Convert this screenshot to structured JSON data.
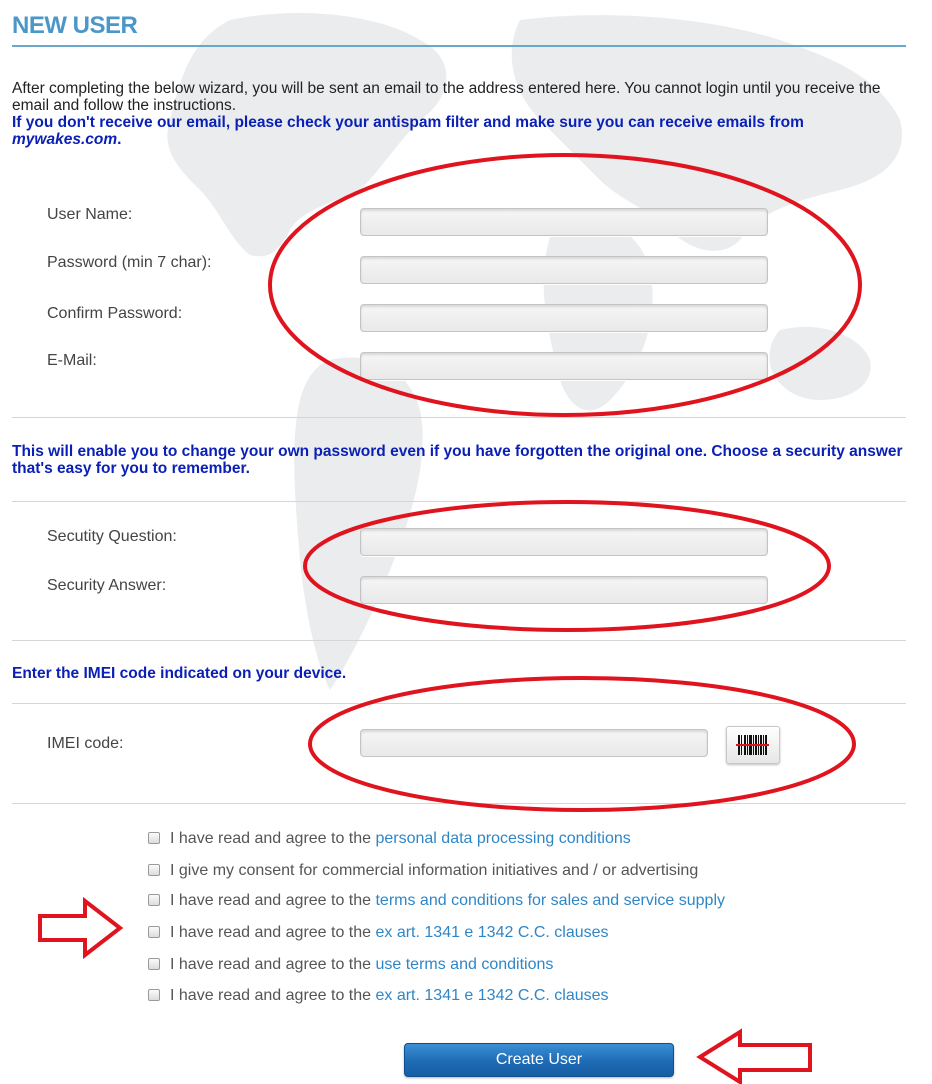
{
  "header": {
    "title": "NEW USER"
  },
  "intro": {
    "text": "After completing the below wizard, you will be sent an email to the address entered here. You cannot login until you receive the email and follow the instructions.",
    "notice_prefix": "If you don't receive our email, please check your antispam filter and make sure you can receive emails from ",
    "notice_domain": "mywakes.com",
    "notice_suffix": "."
  },
  "account": {
    "username_label": "User Name:",
    "username_value": "",
    "password_label": "Password (min 7 char):",
    "password_value": "",
    "confirm_label": "Confirm Password:",
    "confirm_value": "",
    "email_label": "E-Mail:",
    "email_value": ""
  },
  "security": {
    "notice": "This will enable you to change your own password even if you have forgotten the original one. Choose a security answer that's easy for you to remember.",
    "question_label": "Secutity Question:",
    "question_value": "",
    "answer_label": "Security Answer:",
    "answer_value": ""
  },
  "imei": {
    "notice": "Enter the IMEI code indicated on your device.",
    "label": "IMEI code:",
    "value": "",
    "scan_icon": "barcode-icon"
  },
  "agreements": [
    {
      "prefix": "I have read and agree to the ",
      "link": "personal data processing conditions",
      "checked": false
    },
    {
      "prefix": "I give my consent for commercial information initiatives and / or advertising",
      "link": "",
      "checked": false
    },
    {
      "prefix": "I have read and agree to the ",
      "link": "terms and conditions for sales and service supply",
      "checked": false
    },
    {
      "prefix": "I have read and agree to the ",
      "link": "ex art. 1341 e 1342 C.C. clauses",
      "checked": false
    },
    {
      "prefix": "I have read and agree to the ",
      "link": "use terms and conditions",
      "checked": false
    },
    {
      "prefix": "I have read and agree to the ",
      "link": "ex art. 1341 e 1342 C.C. clauses",
      "checked": false
    }
  ],
  "actions": {
    "create_label": "Create User"
  },
  "colors": {
    "title": "#4b97c8",
    "notice": "#0a1fb5",
    "link": "#2f86c7",
    "button": "#1e6bb5",
    "annotation": "#e0141e"
  }
}
